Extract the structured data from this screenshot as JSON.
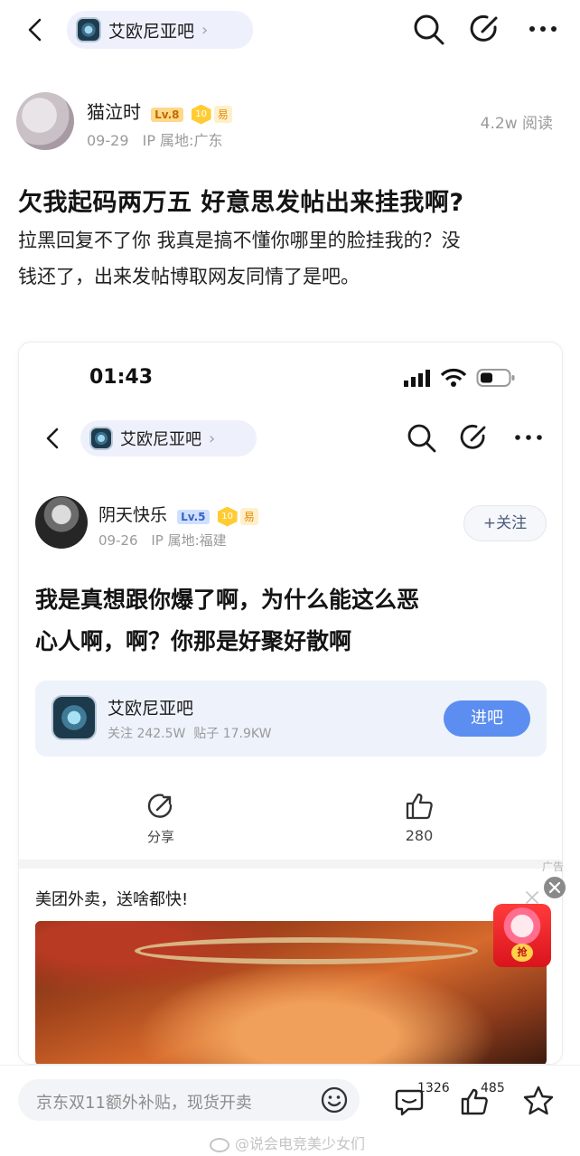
{
  "nav": {
    "forum_name": "艾欧尼亚吧",
    "chevron": "›"
  },
  "post": {
    "author": "猫泣时",
    "level": "Lv.8",
    "coin": "10",
    "easy_tag": "易",
    "date": "09-29",
    "ip": "IP 属地:广东",
    "views": "4.2w 阅读",
    "title": "欠我起码两万五 好意思发帖出来挂我啊?",
    "body_line1": "拉黑回复不了你 我真是搞不懂你哪里的脸挂我的？没",
    "body_line2": "钱还了，出来发帖博取网友同情了是吧。"
  },
  "embedded": {
    "time": "01:43",
    "forum_name": "艾欧尼亚吧",
    "author": "阴天快乐",
    "level": "Lv.5",
    "coin": "10",
    "easy_tag": "易",
    "date": "09-26",
    "ip": "IP 属地:福建",
    "follow": "+关注",
    "title_line1": "我是真想跟你爆了啊，为什么能这么恶",
    "title_line2": "心人啊，啊？你那是好聚好散啊",
    "forum_card_name": "艾欧尼亚吧",
    "forum_card_stats": "关注 242.5W  贴子 17.9KW",
    "enter": "进吧",
    "share": "分享",
    "likes": "280"
  },
  "ad": {
    "tag": "广告",
    "text": "美团外卖，送啥都快!",
    "red_packet": "抢"
  },
  "bottom": {
    "reply_placeholder": "京东双11额外补贴，现货开卖",
    "comments": "1326",
    "likes": "485",
    "watermark": "@说会电竞美少女们"
  },
  "colors": {
    "accent_blue": "#5b8ef0",
    "pill_bg": "#eef1fb",
    "level_gold": "#ffd98a"
  }
}
